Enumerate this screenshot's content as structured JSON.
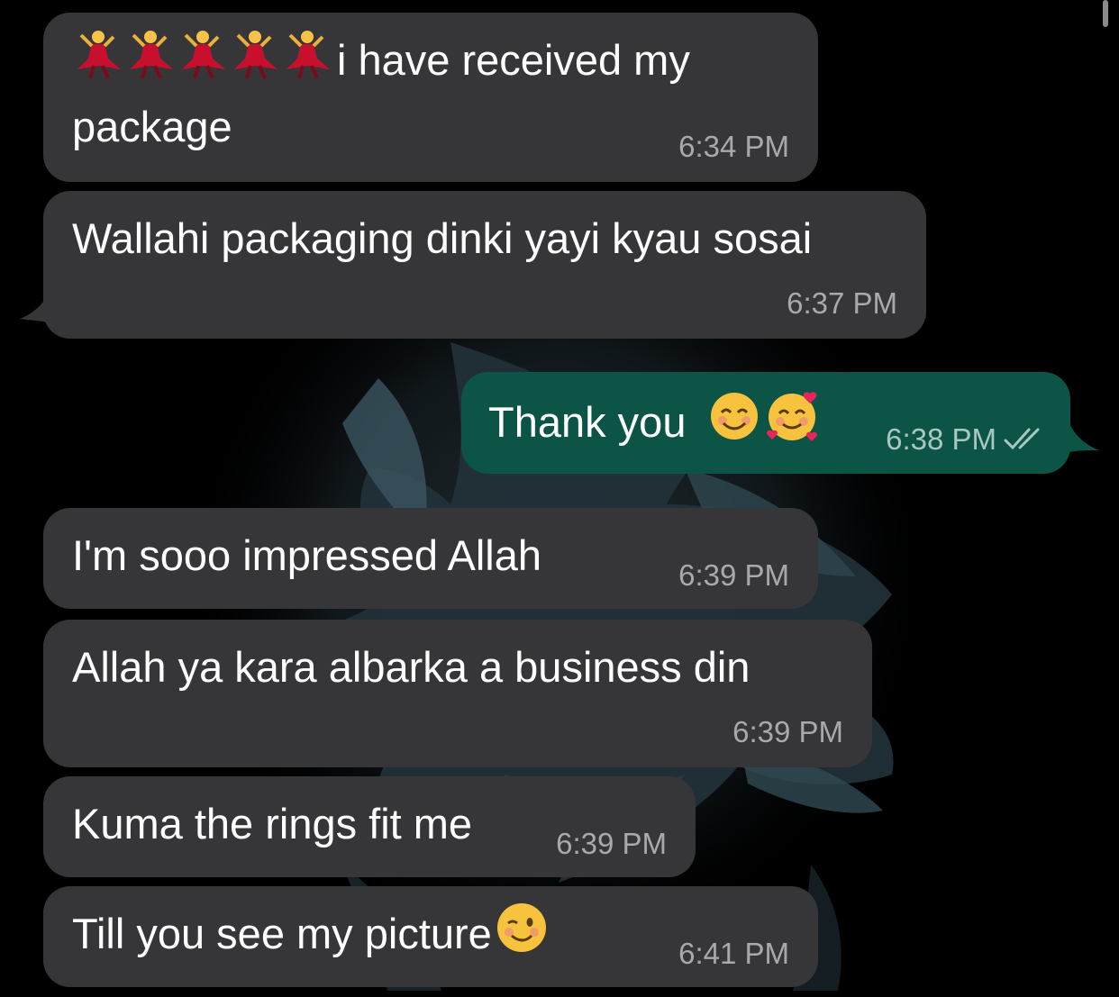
{
  "chat": {
    "messages": [
      {
        "direction": "incoming",
        "emoji_prefix": [
          "woman-dancing",
          "woman-dancing",
          "woman-dancing",
          "woman-dancing",
          "woman-dancing"
        ],
        "text_line1": "i have received my",
        "text_line2": "package",
        "time": "6:34 PM"
      },
      {
        "direction": "incoming",
        "text": "Wallahi packaging dinki yayi kyau sosai",
        "time": "6:37 PM"
      },
      {
        "direction": "outgoing",
        "text": "Thank you",
        "emoji_suffix": [
          "smiling-face-with-smiling-eyes",
          "smiling-face-with-hearts"
        ],
        "time": "6:38 PM",
        "status_icon": "double-check-read"
      },
      {
        "direction": "incoming",
        "text": "I'm sooo impressed Allah",
        "time": "6:39 PM"
      },
      {
        "direction": "incoming",
        "text": "Allah ya kara albarka a business din",
        "time": "6:39 PM"
      },
      {
        "direction": "incoming",
        "text": "Kuma the rings fit me",
        "time": "6:39 PM"
      },
      {
        "direction": "incoming",
        "text": "Till you see my picture",
        "emoji_suffix": [
          "winking-face"
        ],
        "time": "6:41 PM"
      }
    ]
  },
  "colors": {
    "background": "#000000",
    "incoming_bubble": "#363638",
    "outgoing_bubble": "#0b5446",
    "text": "#ffffff",
    "timestamp": "#a9a9ad"
  }
}
